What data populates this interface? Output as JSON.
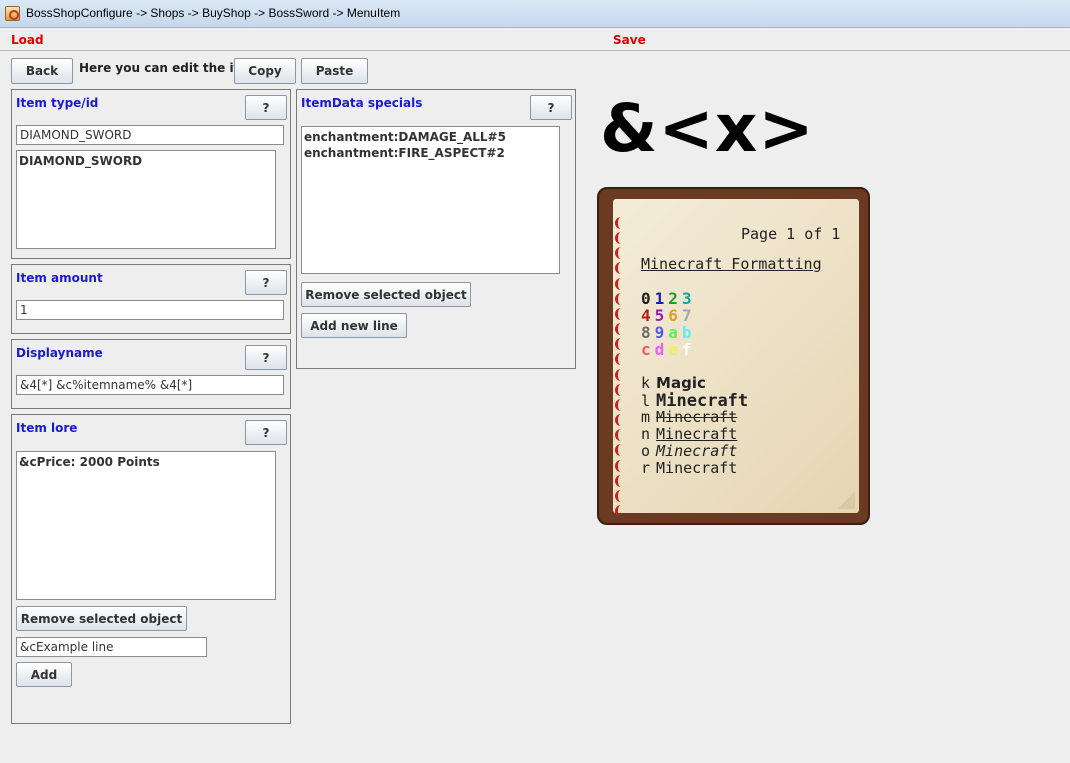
{
  "window": {
    "title": "BossShopConfigure -> Shops -> BuyShop -> BossSword -> MenuItem"
  },
  "menu": {
    "load": "Load",
    "save": "Save"
  },
  "toolbar": {
    "back": "Back",
    "hint": "Here you can edit the item.",
    "copy": "Copy",
    "paste": "Paste"
  },
  "help_label": "?",
  "item_type": {
    "title": "Item type/id",
    "value": "DIAMOND_SWORD",
    "list": [
      "DIAMOND_SWORD"
    ]
  },
  "item_amount": {
    "title": "Item amount",
    "value": "1"
  },
  "displayname": {
    "title": "Displayname",
    "value": "&4[*] &c%itemname% &4[*]"
  },
  "item_lore": {
    "title": "Item lore",
    "list": [
      "&cPrice: 2000 Points"
    ],
    "remove": "Remove selected object",
    "new_line_value": "&cExample line",
    "add": "Add"
  },
  "itemdata": {
    "title": "ItemData specials",
    "list": [
      "enchantment:DAMAGE_ALL#5",
      "enchantment:FIRE_ASPECT#2"
    ],
    "remove": "Remove selected object",
    "add_line": "Add new line"
  },
  "format_ref": {
    "code": "&<x>",
    "page": "Page 1 of 1",
    "heading": "Minecraft Formatting",
    "rows": [
      [
        {
          "c": "0",
          "color": "#222222"
        },
        {
          "c": "1",
          "color": "#1a1ab8"
        },
        {
          "c": "2",
          "color": "#1f9a1f"
        },
        {
          "c": "3",
          "color": "#16a3a3"
        }
      ],
      [
        {
          "c": "4",
          "color": "#b81a1a"
        },
        {
          "c": "5",
          "color": "#9a1ab8"
        },
        {
          "c": "6",
          "color": "#e0a21a"
        },
        {
          "c": "7",
          "color": "#a8a8a8"
        }
      ],
      [
        {
          "c": "8",
          "color": "#6b6b6b"
        },
        {
          "c": "9",
          "color": "#5a5af0"
        },
        {
          "c": "a",
          "color": "#5cf05c"
        },
        {
          "c": "b",
          "color": "#5cf0f0"
        }
      ],
      [
        {
          "c": "c",
          "color": "#f05c5c"
        },
        {
          "c": "d",
          "color": "#f05cf0"
        },
        {
          "c": "e",
          "color": "#f0f05c"
        },
        {
          "c": "f",
          "color": "#ffffff"
        }
      ]
    ],
    "styles": [
      {
        "key": "k",
        "label": "Magic"
      },
      {
        "key": "l",
        "label": "Minecraft"
      },
      {
        "key": "m",
        "label": "Minecraft"
      },
      {
        "key": "n",
        "label": "Minecraft"
      },
      {
        "key": "o",
        "label": "Minecraft"
      },
      {
        "key": "r",
        "label": "Minecraft"
      }
    ]
  }
}
